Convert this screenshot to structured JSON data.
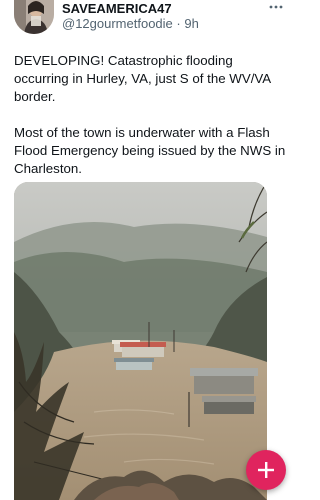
{
  "tweet": {
    "display_name": "SAVEAMERICA47",
    "handle": "@12gourmetfoodie",
    "separator": "·",
    "time": "9h",
    "paragraphs": [
      "DEVELOPING! Catastrophic flooding occurring in Hurley, VA, just S of the WV/VA border.",
      "Most of the town is underwater with a Flash Flood Emergency being issued by the NWS in Charleston."
    ]
  },
  "icons": {
    "more": "more-horizontal-icon",
    "compose": "plus-icon"
  },
  "colors": {
    "accent": "#e0245e",
    "secondary_text": "#536471",
    "primary_text": "#0f1419"
  }
}
